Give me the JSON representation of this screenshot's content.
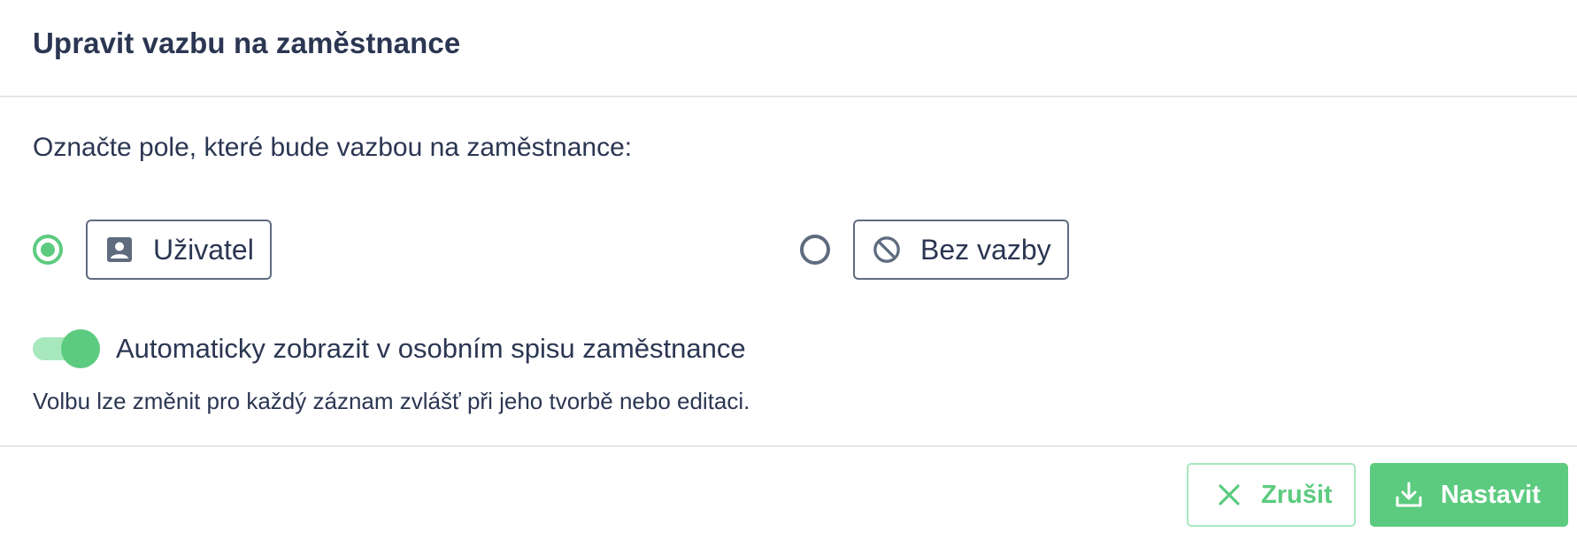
{
  "dialog": {
    "title": "Upravit vazbu na zaměstnance",
    "prompt": "Označte pole, které bude vazbou na zaměstnance:",
    "options": [
      {
        "label": "Uživatel",
        "icon": "user-badge-icon",
        "selected": true
      },
      {
        "label": "Bez vazby",
        "icon": "ban-icon",
        "selected": false
      }
    ],
    "toggle": {
      "label": "Automaticky zobrazit v osobním spisu zaměstnance",
      "on": true
    },
    "hint": "Volbu lze změnit pro každý záznam zvlášť při jeho tvorbě nebo editaci.",
    "buttons": {
      "cancel_label": "Zrušit",
      "cancel_icon": "close-icon",
      "submit_label": "Nastavit",
      "submit_icon": "download-icon"
    }
  },
  "colors": {
    "accent": "#5ccb7f",
    "accent_light": "#a7e8bd",
    "text": "#2b3652",
    "border": "#5f6b7f",
    "divider": "#e3e6ea"
  }
}
